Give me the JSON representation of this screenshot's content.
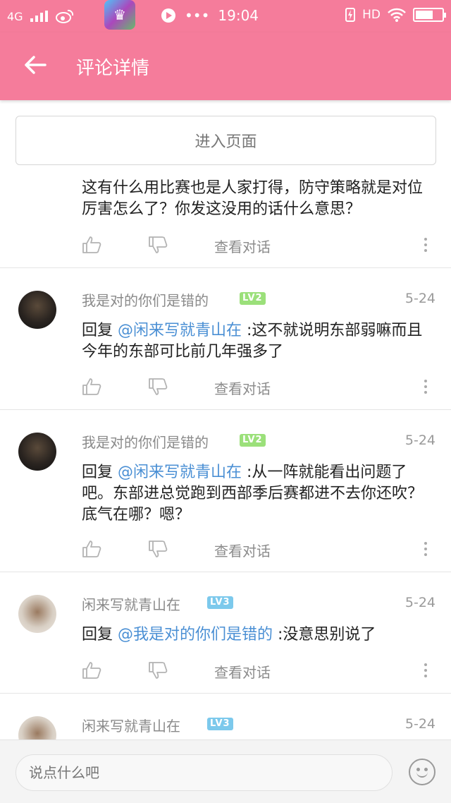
{
  "status_bar": {
    "network": "4G",
    "time": "19:04",
    "hd_label": "HD"
  },
  "header": {
    "title": "评论详情"
  },
  "enter_page_label": "进入页面",
  "comments": [
    {
      "text": "这有什么用比赛也是人家打得，防守策略就是对位厉害怎么了？你发这没用的话什么意思？",
      "action_label": "查看对话"
    },
    {
      "username": "我是对的你们是错的",
      "level": "LV2",
      "date": "5-24",
      "reply_prefix": "回复 ",
      "mention": "@闲来写就青山在",
      "text": " :这不就说明东部弱嘛而且今年的东部可比前几年强多了",
      "action_label": "查看对话"
    },
    {
      "username": "我是对的你们是错的",
      "level": "LV2",
      "date": "5-24",
      "reply_prefix": "回复 ",
      "mention": "@闲来写就青山在",
      "text": " :从一阵就能看出问题了吧。东部进总觉跑到西部季后赛都进不去你还吹？底气在哪？嗯？",
      "action_label": "查看对话"
    },
    {
      "username": "闲来写就青山在",
      "level": "LV3",
      "date": "5-24",
      "reply_prefix": "回复 ",
      "mention": "@我是对的你们是错的",
      "text": " :没意思别说了",
      "action_label": "查看对话"
    },
    {
      "username": "闲来写就青山在",
      "level": "LV3",
      "date": "5-24"
    }
  ],
  "input": {
    "placeholder": "说点什么吧"
  },
  "colors": {
    "brand_pink": "#f57c9b",
    "mention_blue": "#4a8fd4",
    "lv2_green": "#9be07a",
    "lv3_blue": "#7cc9ec"
  }
}
